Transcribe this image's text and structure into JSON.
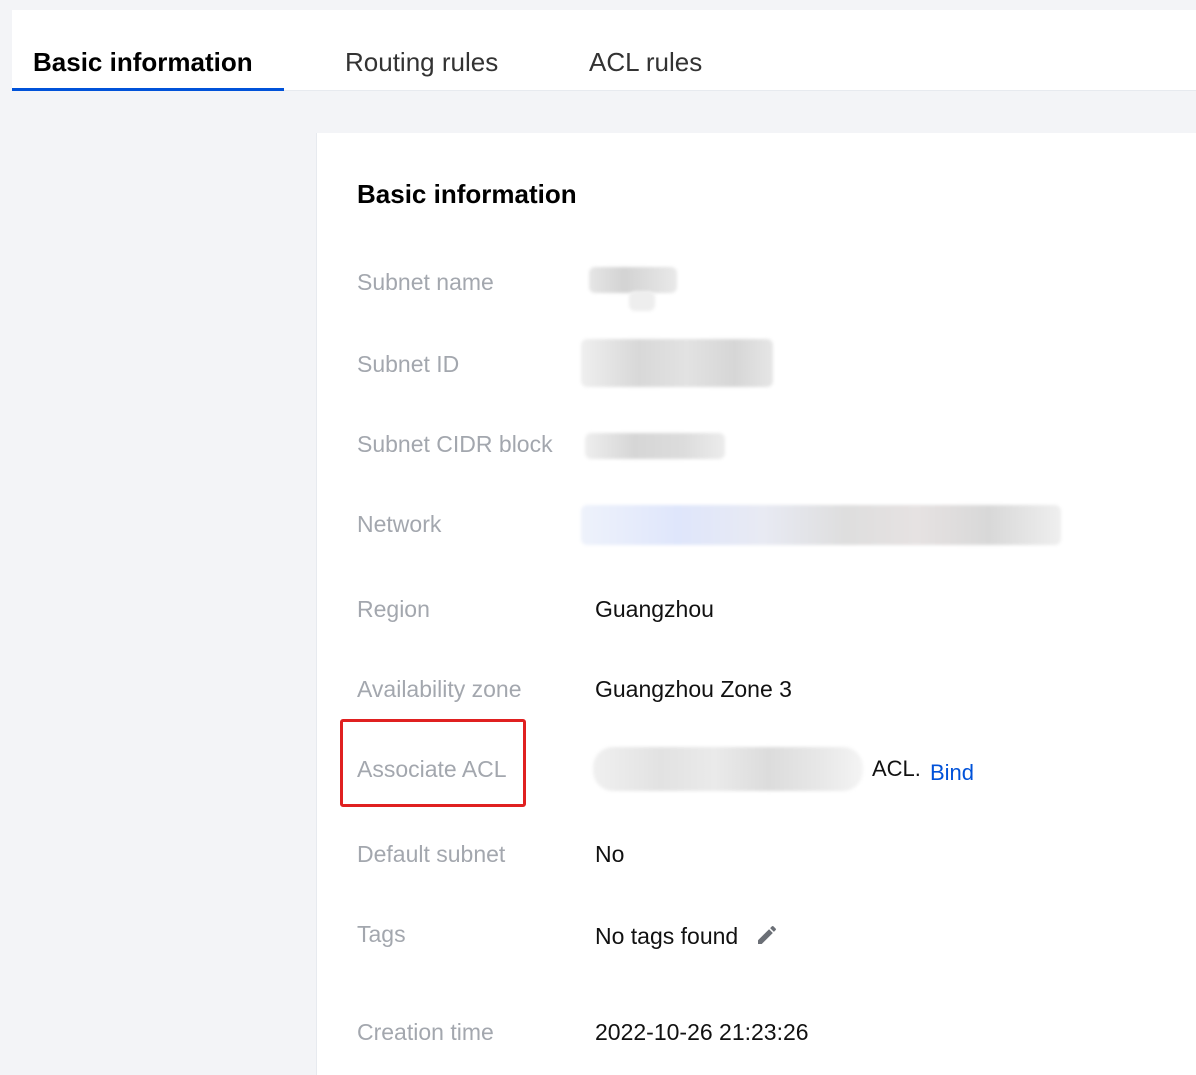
{
  "tabs": [
    {
      "label": "Basic information",
      "active": true
    },
    {
      "label": "Routing rules",
      "active": false
    },
    {
      "label": "ACL rules",
      "active": false
    }
  ],
  "card": {
    "title": "Basic information",
    "rows": {
      "subnet_name": {
        "label": "Subnet name"
      },
      "subnet_id": {
        "label": "Subnet ID"
      },
      "cidr": {
        "label": "Subnet CIDR block"
      },
      "network": {
        "label": "Network"
      },
      "region": {
        "label": "Region",
        "value": "Guangzhou"
      },
      "zone": {
        "label": "Availability zone",
        "value": "Guangzhou Zone 3"
      },
      "acl": {
        "label": "Associate ACL",
        "value_suffix": "ACL.",
        "action": "Bind"
      },
      "default_subnet": {
        "label": "Default subnet",
        "value": "No"
      },
      "tags": {
        "label": "Tags",
        "value": "No tags found",
        "icon": "pencil-icon"
      },
      "created": {
        "label": "Creation time",
        "value": "2022-10-26 21:23:26"
      }
    }
  },
  "colors": {
    "accent": "#0052d9",
    "highlight": "#e02020",
    "label": "#a3a7ae"
  }
}
